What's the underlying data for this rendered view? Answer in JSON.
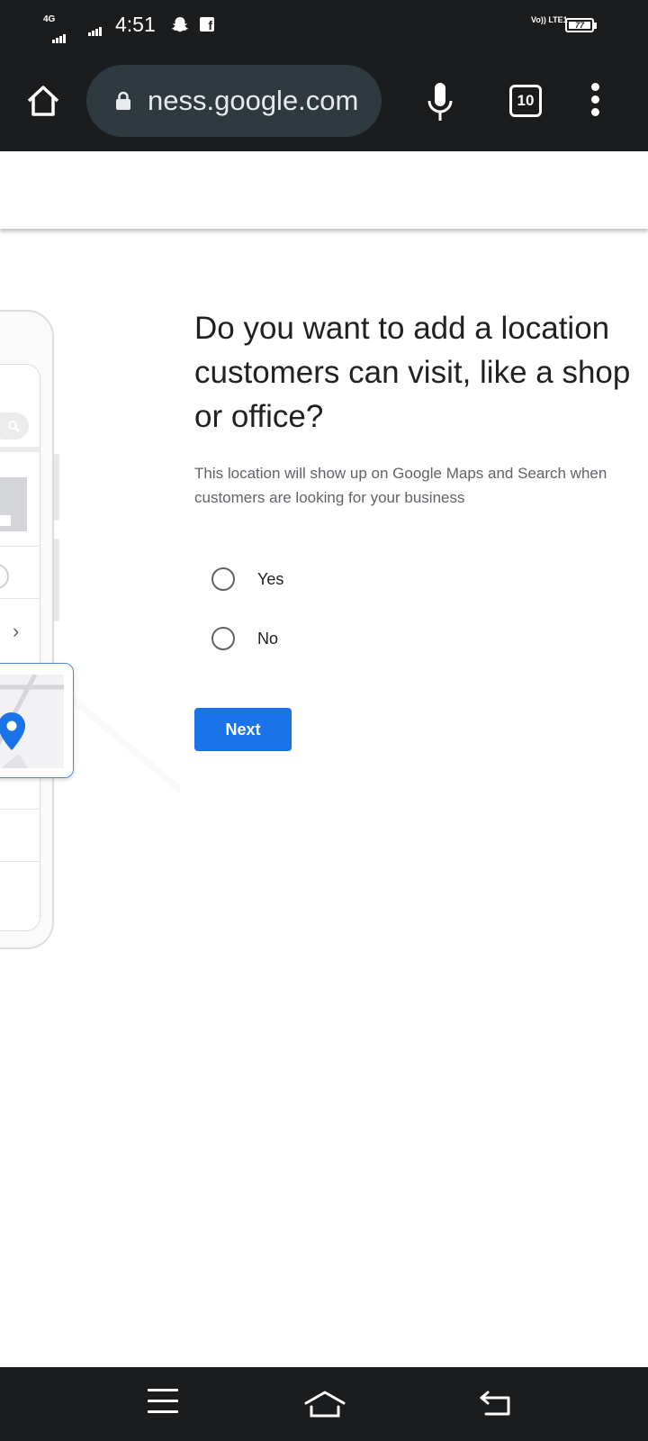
{
  "status_bar": {
    "network_label": "4G",
    "time": "4:51",
    "volte_label": "Vo)) LTE1",
    "battery": "77"
  },
  "browser": {
    "url": "ness.google.com",
    "tab_count": "10"
  },
  "form": {
    "title": "Do you want to add a location customers can visit, like a shop or office?",
    "subtitle": "This location will show up on Google Maps and Search when customers are looking for your business",
    "options": [
      {
        "label": "Yes",
        "selected": false
      },
      {
        "label": "No",
        "selected": false
      }
    ],
    "next_label": "Next"
  },
  "colors": {
    "accent": "#1a73e8",
    "chrome_bg": "#1b1c1e",
    "urlbar_bg": "#2e3a40"
  },
  "icons": {
    "toolbar": [
      "home-icon",
      "lock-icon",
      "mic-icon",
      "tab-switcher-icon",
      "more-vert-icon"
    ],
    "navigation": [
      "recents-icon",
      "home-gesture-icon",
      "back-icon"
    ]
  }
}
